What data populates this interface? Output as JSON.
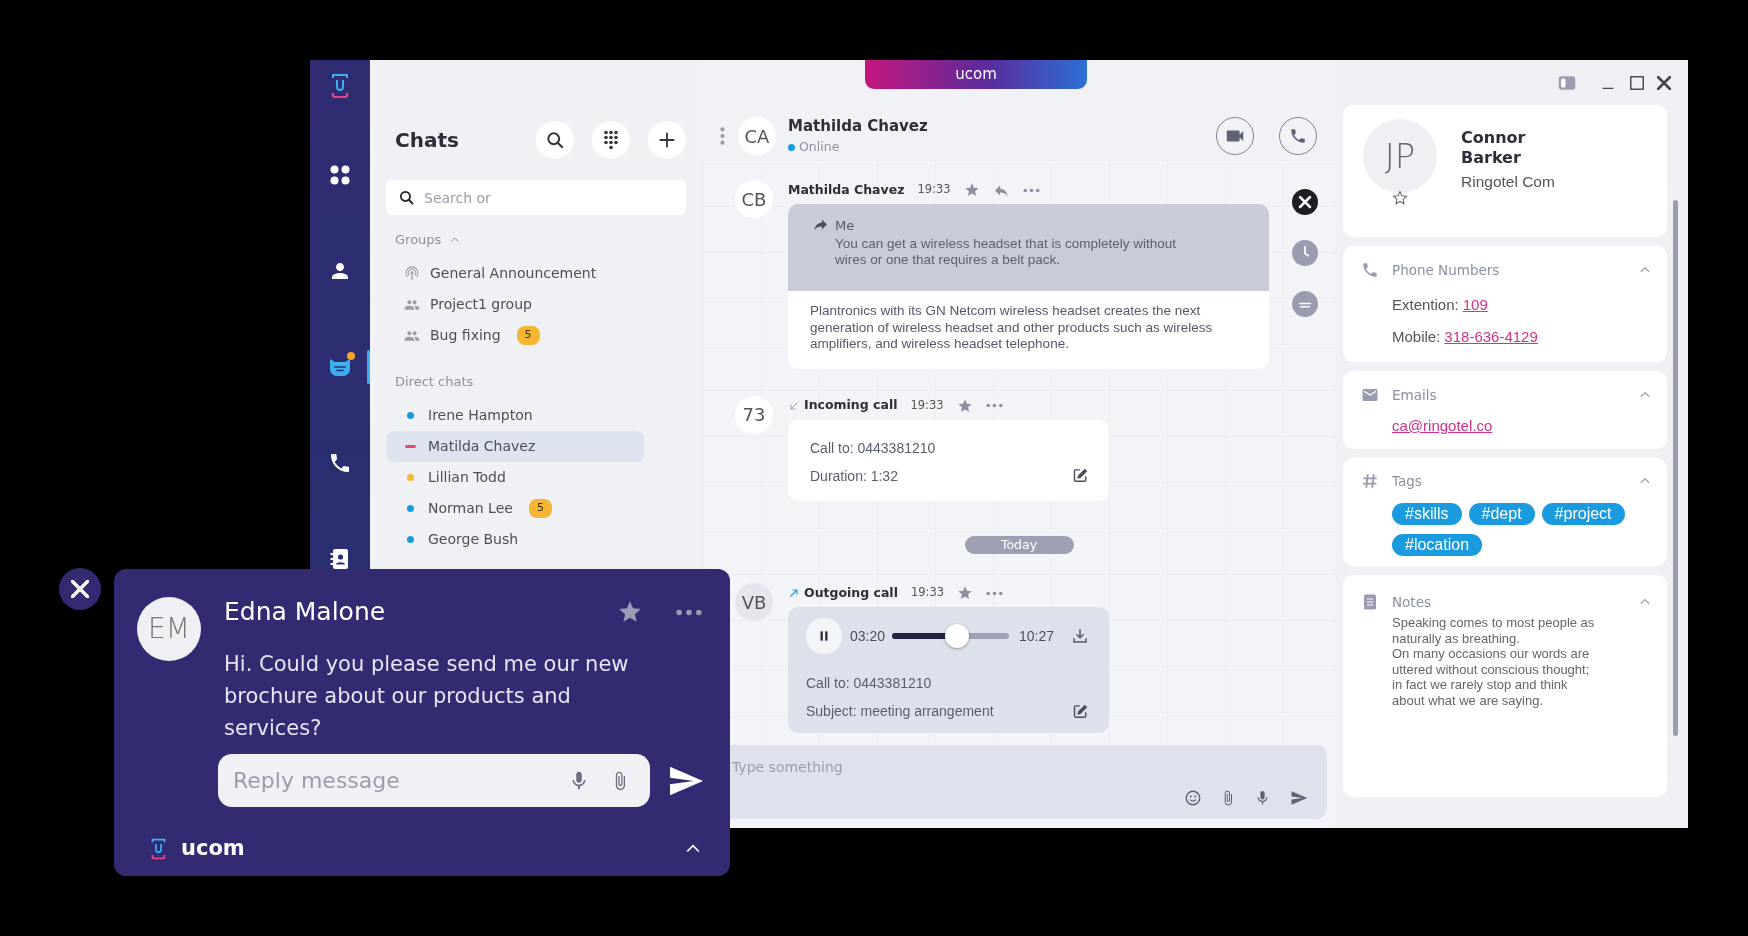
{
  "logo": {
    "text": "ucom"
  },
  "rail": [
    {
      "kind": "apps",
      "selected": false,
      "unread": false
    },
    {
      "kind": "contacts",
      "selected": false,
      "unread": false
    },
    {
      "kind": "chats",
      "selected": true,
      "unread": true
    },
    {
      "kind": "calls",
      "selected": false,
      "unread": false
    },
    {
      "kind": "directory",
      "selected": false,
      "unread": false
    }
  ],
  "chats_panel": {
    "title": "Chats",
    "search": {
      "placeholder": "Search or"
    },
    "groups": {
      "label": "Groups",
      "expanded": true,
      "items": [
        {
          "kind": "broadcast",
          "name": "General Announcement"
        },
        {
          "kind": "group",
          "name": "Project1 group"
        },
        {
          "kind": "group",
          "name": "Bug fixing",
          "badge": "5"
        }
      ]
    },
    "direct": {
      "label": "Direct chats",
      "items": [
        {
          "name": "Irene Hampton",
          "kind": "dot",
          "color": "#1a9be0",
          "selected": false
        },
        {
          "name": "Matilda Chavez",
          "kind": "dash",
          "color": "#e8456b",
          "selected": true
        },
        {
          "name": "Lillian Todd",
          "kind": "dot",
          "color": "#f5b731",
          "selected": false
        },
        {
          "name": "Norman Lee",
          "kind": "dot",
          "color": "#1a9be0",
          "selected": false,
          "badge": "5"
        },
        {
          "name": "George Bush",
          "kind": "dot",
          "color": "#1a9be0",
          "selected": false
        }
      ]
    }
  },
  "chat": {
    "header": {
      "avatar": "CA",
      "name": "Mathilda Chavez",
      "status": "Online"
    },
    "messages": [
      {
        "kind": "text",
        "avatar": "CB",
        "sender": "Mathilda Chavez",
        "time": "19:33",
        "quote": {
          "author": "Me",
          "text": "You can get a wireless headset that is completely without wires or one that requires a belt pack."
        },
        "text": "Plantronics with its GN Netcom wireless headset creates the next generation of wireless headset and other products such as wireless amplifiers, and wireless headset telephone."
      },
      {
        "kind": "incoming_call",
        "avatar": "73",
        "title": "Incoming call",
        "time": "19:33",
        "lines": [
          "Call to: 0443381210",
          "Duration: 1:32"
        ]
      },
      {
        "kind": "separator",
        "label": "Today"
      },
      {
        "kind": "outgoing_call",
        "avatar": "VB",
        "title": "Outgoing call",
        "time": "19:33",
        "recording": {
          "elapsed": "03:20",
          "total": "10:27",
          "level": 0.55,
          "playing": true
        },
        "lines": [
          "Call to: 0443381210",
          "Subject: meeting arrangement"
        ]
      }
    ],
    "composer": {
      "placeholder": "Type something"
    }
  },
  "contact": {
    "avatar": "JP",
    "name": "Connor Barker",
    "company": "Ringotel Com",
    "favorite": false,
    "sections": [
      {
        "kind": "phones",
        "title": "Phone Numbers",
        "expanded": true,
        "rows": [
          {
            "label": "Extention:",
            "value": "109"
          },
          {
            "label": "Mobile:",
            "value": "318-636-4129"
          }
        ]
      },
      {
        "kind": "emails",
        "title": "Emails",
        "expanded": true,
        "links": [
          "ca@ringotel.co"
        ]
      },
      {
        "kind": "tags",
        "title": "Tags",
        "expanded": true,
        "tags": [
          "#skills",
          "#dept",
          "#project",
          "#location"
        ]
      },
      {
        "kind": "notes",
        "title": "Notes",
        "expanded": true,
        "text": "Speaking comes to most people as naturally as breathing.\nOn many occasions our words are uttered without conscious thought; in fact we rarely stop and think about what we are saying."
      }
    ]
  },
  "popup": {
    "avatar": "EM",
    "name": "Edna Malone",
    "text": "Hi. Could you please send me our new brochure about our products and services?",
    "reply": {
      "placeholder": "Reply message"
    },
    "brand": "ucom",
    "expanded": false
  }
}
